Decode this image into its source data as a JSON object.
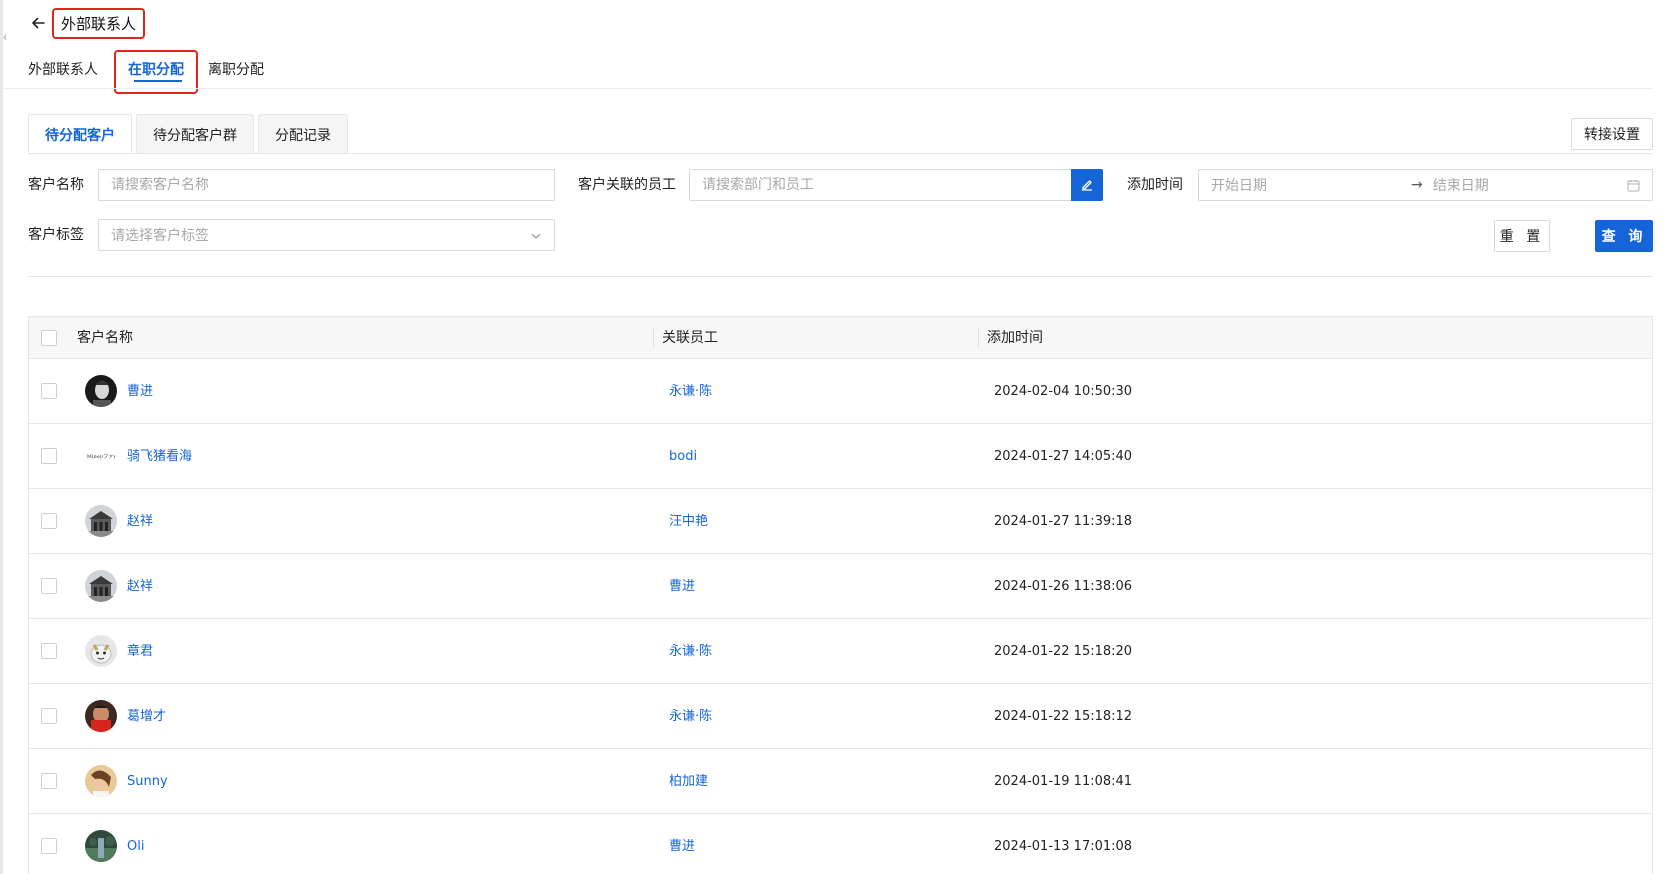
{
  "header": {
    "title": "外部联系人"
  },
  "top_tabs": [
    {
      "label": "外部联系人"
    },
    {
      "label": "在职分配"
    },
    {
      "label": "离职分配"
    }
  ],
  "sub_tabs": [
    {
      "label": "待分配客户"
    },
    {
      "label": "待分配客户群"
    },
    {
      "label": "分配记录"
    }
  ],
  "transfer_settings_label": "转接设置",
  "filters": {
    "customer_name_label": "客户名称",
    "customer_name_placeholder": "请搜索客户名称",
    "employee_label": "客户关联的员工",
    "employee_placeholder": "请搜索部门和员工",
    "add_time_label": "添加时间",
    "start_date_placeholder": "开始日期",
    "end_date_placeholder": "结束日期",
    "tag_label": "客户标签",
    "tag_placeholder": "请选择客户标签",
    "reset_label": "重 置",
    "query_label": "查 询"
  },
  "table": {
    "columns": [
      "客户名称",
      "关联员工",
      "添加时间"
    ],
    "rows": [
      {
        "customer": "曹进",
        "employee": "永谦·陈",
        "time": "2024-02-04 10:50:30",
        "avatar": "bw-portrait"
      },
      {
        "customer": "骑飞猪看海",
        "employee": "bodi",
        "time": "2024-01-27 14:05:40",
        "avatar": "text-logo",
        "avatar_text": "Mine(/ファ)"
      },
      {
        "customer": "赵祥",
        "employee": "汪中艳",
        "time": "2024-01-27 11:39:18",
        "avatar": "building"
      },
      {
        "customer": "赵祥",
        "employee": "曹进",
        "time": "2024-01-26 11:38:06",
        "avatar": "building"
      },
      {
        "customer": "章君",
        "employee": "永谦·陈",
        "time": "2024-01-22 15:18:20",
        "avatar": "cartoon"
      },
      {
        "customer": "葛增才",
        "employee": "永谦·陈",
        "time": "2024-01-22 15:18:12",
        "avatar": "red-portrait"
      },
      {
        "customer": "Sunny",
        "employee": "柏加建",
        "time": "2024-01-19 11:08:41",
        "avatar": "woman"
      },
      {
        "customer": "Oli",
        "employee": "曹进",
        "time": "2024-01-13 17:01:08",
        "avatar": "landscape"
      }
    ]
  },
  "colors": {
    "accent": "#1565d8",
    "highlight_border": "#e0261c"
  }
}
